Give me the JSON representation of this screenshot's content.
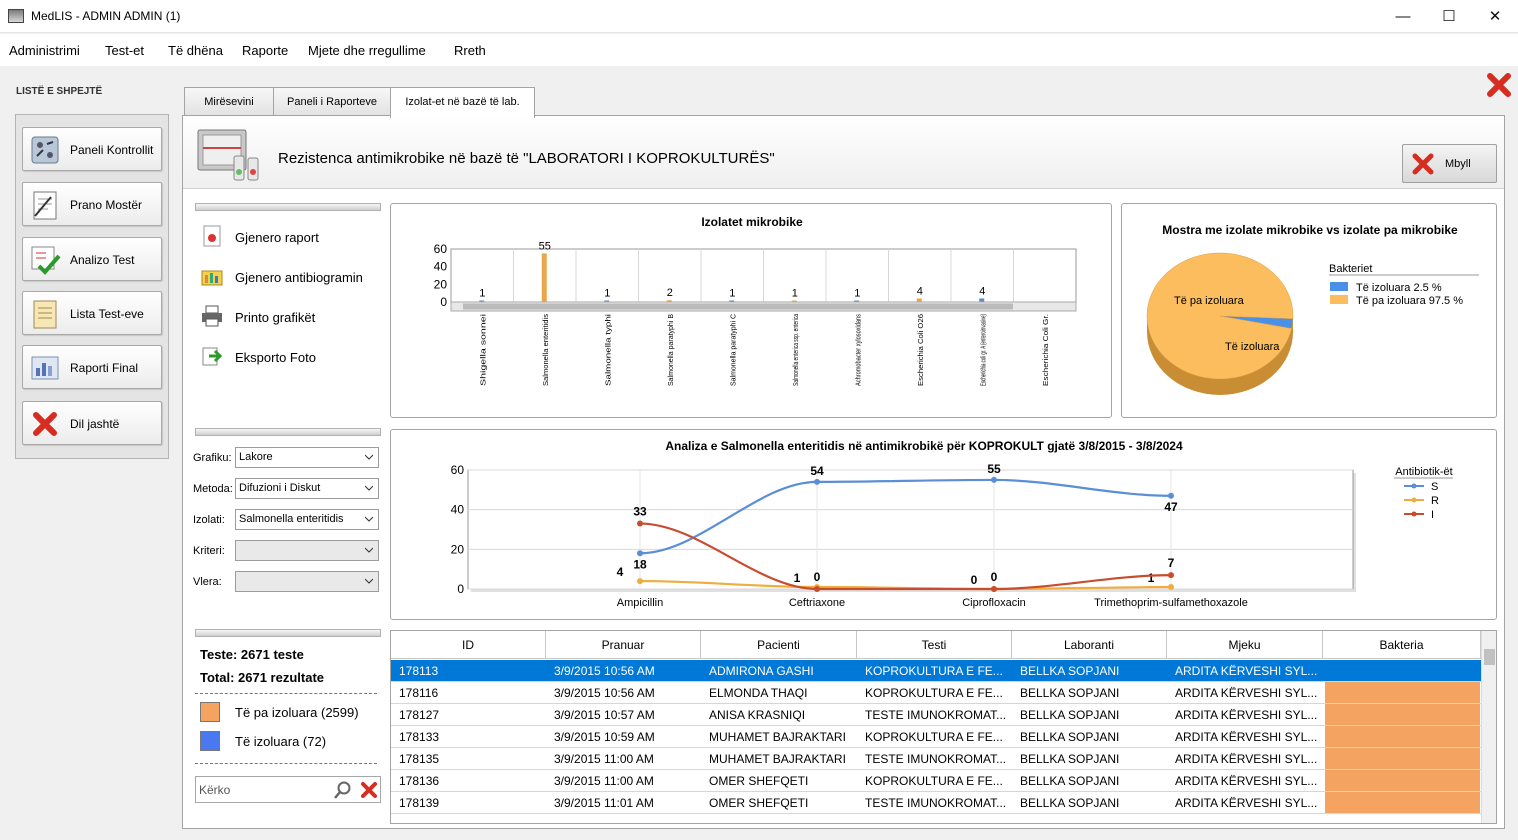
{
  "window": {
    "title": "MedLIS - ADMIN ADMIN (1)",
    "minimize": "—",
    "maximize": "☐",
    "close": "✕"
  },
  "menu": [
    "Administrimi",
    "Test-et",
    "Të dhëna",
    "Raporte",
    "Mjete dhe rregullime",
    "Rreth"
  ],
  "quick_list": {
    "title": "LISTË E SHPEJTË",
    "items": [
      {
        "label": "Paneli Kontrollit",
        "icon": "control-panel-icon"
      },
      {
        "label": "Prano Mostër",
        "icon": "sample-form-icon"
      },
      {
        "label": "Analizo Test",
        "icon": "analyze-checkmark-icon"
      },
      {
        "label": "Lista Test-eve",
        "icon": "test-list-icon"
      },
      {
        "label": "Raporti Final",
        "icon": "final-report-icon"
      },
      {
        "label": "Dil jashtë",
        "icon": "exit-x-icon"
      }
    ]
  },
  "tabs": [
    "Mirësevini",
    "Paneli i Raporteve",
    "Izolat-et në bazë të lab."
  ],
  "header": {
    "title": "Rezistenca antimikrobike në bazë të \"LABORATORI I KOPROKULTURËS\"",
    "close_button": "Mbyll"
  },
  "actions": [
    {
      "label": "Gjenero raport",
      "icon": "report-icon"
    },
    {
      "label": "Gjenero antibiogramin",
      "icon": "antibiogram-icon"
    },
    {
      "label": "Printo grafikët",
      "icon": "printer-icon"
    },
    {
      "label": "Eksporto Foto",
      "icon": "export-icon"
    }
  ],
  "filters": [
    {
      "label": "Grafiku:",
      "value": "Lakore"
    },
    {
      "label": "Metoda:",
      "value": "Difuzioni i Diskut"
    },
    {
      "label": "Izolati:",
      "value": "Salmonella enteritidis"
    },
    {
      "label": "Kriteri:",
      "value": ""
    },
    {
      "label": "Vlera:",
      "value": ""
    }
  ],
  "summary": {
    "tests": "Teste: 2671 teste",
    "total": "Total: 2671 rezultate",
    "legend": [
      {
        "label": "Të pa izoluara (2599)",
        "color": "#f4a460"
      },
      {
        "label": "Të izoluara (72)",
        "color": "#4a78f0"
      }
    ]
  },
  "search": {
    "placeholder": "Kërko"
  },
  "chart_data": [
    {
      "type": "bar",
      "title": "Izolatet mikrobike",
      "ylim": [
        0,
        60
      ],
      "yticks": [
        0,
        20,
        40,
        60
      ],
      "categories": [
        "Shigella sonnei",
        "Salmonella enteritidis",
        "Salmonella typhi",
        "Salmonella paratyphi B",
        "Salmonella paratyphi C",
        "Salmonella enterica ssp. enterica",
        "Achromobacter xylosoxidans",
        "Escherichia Coli O26",
        "Escherichia coli gr. A (enteroinvasive)",
        "Escherichia Coli Gr."
      ],
      "values": [
        1,
        55,
        1,
        2,
        1,
        1,
        1,
        4,
        4,
        null
      ]
    },
    {
      "type": "pie",
      "title": "Mostra me izolate mikrobike vs izolate pa mikrobike",
      "legend_title": "Bakteriet",
      "slices": [
        {
          "name": "Të izoluara",
          "value": 2.5,
          "legend": "Të izoluara 2.5 %",
          "color": "#4a8fe8"
        },
        {
          "name": "Të pa izoluara",
          "value": 97.5,
          "legend": "Të pa izoluara 97.5 %",
          "color": "#fbbd5e"
        }
      ],
      "labels": [
        "Të pa izoluara",
        "Të izoluara"
      ]
    },
    {
      "type": "line",
      "title": "Analiza e Salmonella enteritidis në antimikrobikë për KOPROKULT gjatë 3/8/2015 - 3/8/2024",
      "legend_title": "Antibiotik-ët",
      "categories": [
        "Ampicillin",
        "Ceftriaxone",
        "Ciprofloxacin",
        "Trimethoprim-sulfamethoxazole"
      ],
      "ylim": [
        0,
        60
      ],
      "yticks": [
        0,
        20,
        40,
        60
      ],
      "series": [
        {
          "name": "S",
          "values": [
            18,
            54,
            55,
            47
          ],
          "color": "#5a8ed6"
        },
        {
          "name": "R",
          "values": [
            4,
            1,
            0,
            1
          ],
          "color": "#f0ad3e"
        },
        {
          "name": "I",
          "values": [
            33,
            0,
            0,
            7
          ],
          "color": "#c84d2c"
        }
      ]
    }
  ],
  "table": {
    "columns": [
      "ID",
      "Pranuar",
      "Pacienti",
      "Testi",
      "Laboranti",
      "Mjeku",
      "Bakteria"
    ],
    "rows": [
      [
        "178113",
        "3/9/2015 10:56 AM",
        "ADMIRONA GASHI",
        "KOPROKULTURA E FE...",
        "BELLKA SOPJANI",
        "ARDITA KËRVESHI SYL...",
        ""
      ],
      [
        "178116",
        "3/9/2015 10:56 AM",
        "ELMONDA THAQI",
        "KOPROKULTURA E FE...",
        "BELLKA SOPJANI",
        "ARDITA KËRVESHI SYL...",
        ""
      ],
      [
        "178127",
        "3/9/2015 10:57 AM",
        "ANISA KRASNIQI",
        "TESTE IMUNOKROMAT...",
        "BELLKA SOPJANI",
        "ARDITA KËRVESHI SYL...",
        ""
      ],
      [
        "178133",
        "3/9/2015 10:59 AM",
        "MUHAMET BAJRAKTARI",
        "KOPROKULTURA E FE...",
        "BELLKA SOPJANI",
        "ARDITA KËRVESHI SYL...",
        ""
      ],
      [
        "178135",
        "3/9/2015 11:00 AM",
        "MUHAMET BAJRAKTARI",
        "TESTE IMUNOKROMAT...",
        "BELLKA SOPJANI",
        "ARDITA KËRVESHI SYL...",
        ""
      ],
      [
        "178136",
        "3/9/2015 11:00 AM",
        "OMER SHEFQETI",
        "KOPROKULTURA E FE...",
        "BELLKA SOPJANI",
        "ARDITA KËRVESHI SYL...",
        ""
      ],
      [
        "178139",
        "3/9/2015 11:01 AM",
        "OMER SHEFQETI",
        "TESTE IMUNOKROMAT...",
        "BELLKA SOPJANI",
        "ARDITA KËRVESHI SYL...",
        ""
      ]
    ]
  }
}
